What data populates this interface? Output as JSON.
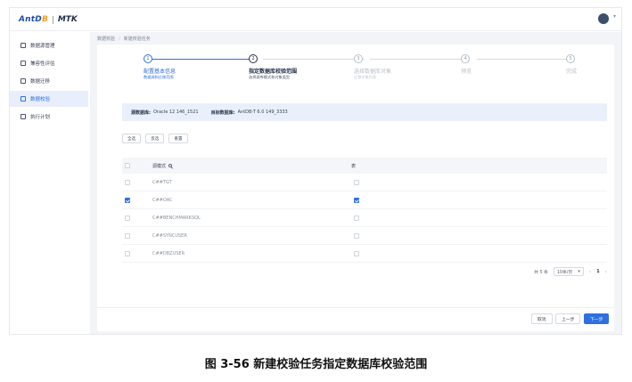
{
  "app": {
    "logo_main": "AntD",
    "logo_accent": "B",
    "logo_product": "MTK"
  },
  "sidebar": {
    "items": [
      {
        "label": "数据源管理",
        "icon": "database-icon",
        "active": false
      },
      {
        "label": "兼容性评估",
        "icon": "assessment-icon",
        "active": false
      },
      {
        "label": "数据迁移",
        "icon": "migrate-icon",
        "active": false
      },
      {
        "label": "数据校验",
        "icon": "verify-icon",
        "active": true
      },
      {
        "label": "执行计划",
        "icon": "calendar-icon",
        "active": false
      }
    ]
  },
  "breadcrumb": {
    "parent": "数据校验",
    "current": "新建校验任务"
  },
  "steps": [
    {
      "num": "1",
      "title": "配置基本信息",
      "sub": "数据源和迁移范围",
      "state": "done"
    },
    {
      "num": "2",
      "title": "指定数据库校验范围",
      "sub": "选择源库模式和对象类型",
      "state": "current"
    },
    {
      "num": "3",
      "title": "选择数据库对象",
      "sub": "迁移对象列表",
      "state": "todo"
    },
    {
      "num": "4",
      "title": "预览",
      "sub": "",
      "state": "todo"
    },
    {
      "num": "5",
      "title": "完成",
      "sub": "",
      "state": "todo"
    }
  ],
  "db_info": {
    "source_label": "源数据库:",
    "source_value": "Oracle 12 146_1521",
    "target_label": "目标数据库:",
    "target_value": "AntDB-T 6.0 149_3333"
  },
  "actions": {
    "all": "全选",
    "invert": "反选",
    "reset": "重置"
  },
  "table": {
    "header_schema": "源模式",
    "header_check": "表",
    "rows": [
      {
        "schema": "C##TGT",
        "selected": false,
        "table_checked": false
      },
      {
        "schema": "C##OAC",
        "selected": true,
        "table_checked": true
      },
      {
        "schema": "C##BENCHMARKSQL",
        "selected": false,
        "table_checked": false
      },
      {
        "schema": "C##SYNCUSER",
        "selected": false,
        "table_checked": false
      },
      {
        "schema": "C##DBZUSER",
        "selected": false,
        "table_checked": false
      }
    ]
  },
  "pagination": {
    "total": "共 5 条",
    "page_size": "10条/页",
    "current_page": "1"
  },
  "footer": {
    "cancel": "取消",
    "prev": "上一步",
    "next": "下一步"
  },
  "caption": "图 3-56 新建校验任务指定数据库校验范围",
  "colors": {
    "primary": "#2f6fdf",
    "info_bg": "#e9f0fc"
  }
}
